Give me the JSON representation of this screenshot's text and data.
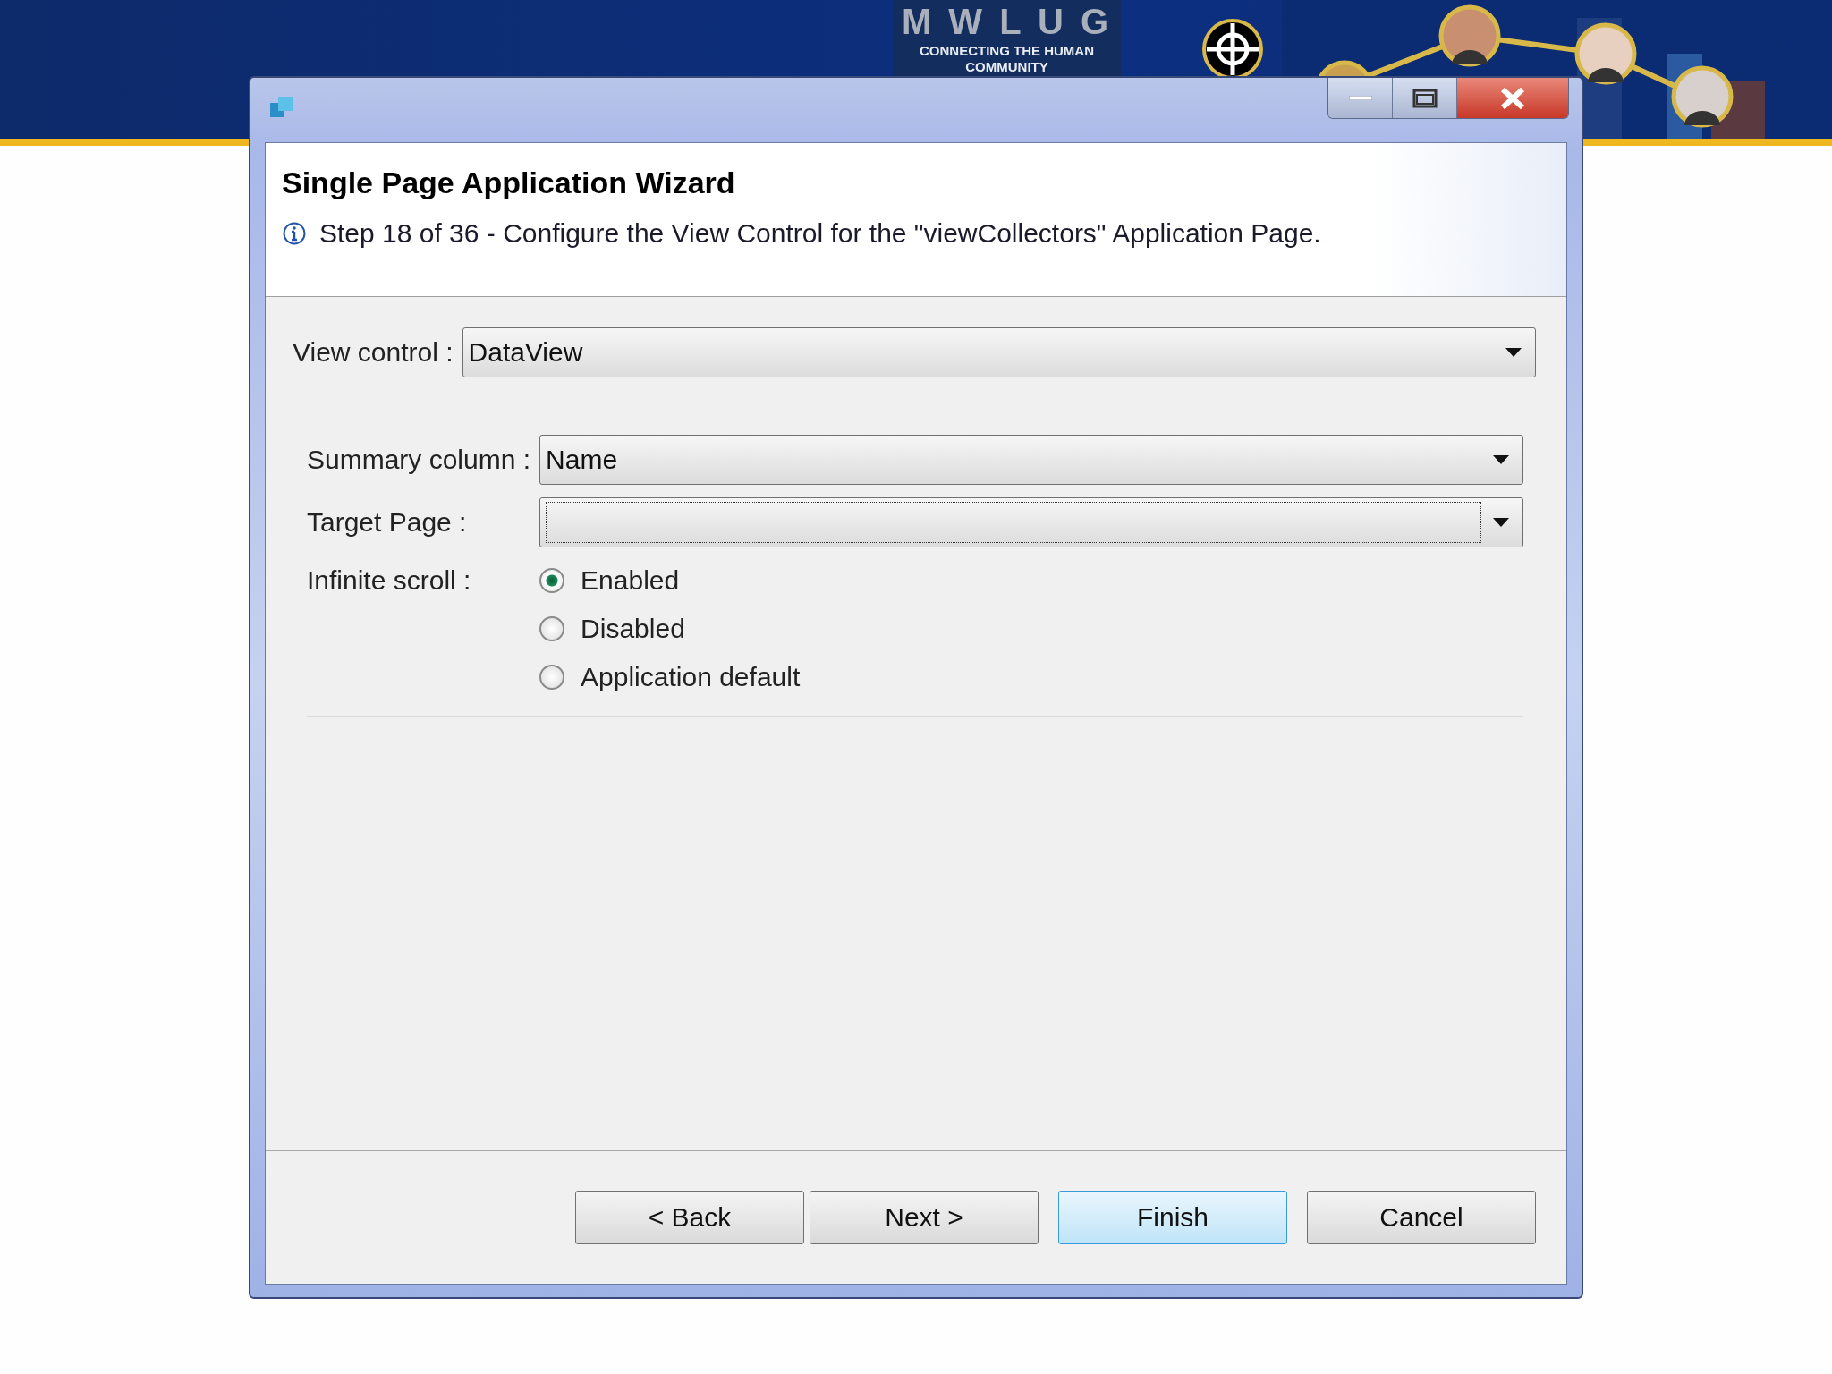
{
  "banner": {
    "logo": {
      "letters": "M W L U G",
      "tagline": [
        "CONNECTING THE HUMAN",
        "COMMUNITY"
      ]
    }
  },
  "wizard": {
    "title": "Single Page Application Wizard",
    "message": "Step 18 of 36 - Configure the View Control for the \"viewCollectors\" Application Page.",
    "main_field": {
      "kind": "combo",
      "label": "View control :",
      "value": "DataView",
      "focused": false
    },
    "fields": [
      {
        "kind": "combo",
        "label": "Summary column :",
        "value": "Name",
        "focused": false
      },
      {
        "kind": "combo",
        "label": "Target Page :",
        "focused": true
      },
      {
        "kind": "radio",
        "label": "Infinite scroll :",
        "options": [
          {
            "label": "Enabled",
            "selected": true
          },
          {
            "label": "Disabled",
            "selected": false
          },
          {
            "label": "Application default",
            "selected": false
          }
        ]
      }
    ],
    "buttons": [
      {
        "label": "< Back",
        "default": false
      },
      {
        "label": "Next >",
        "default": false
      },
      {
        "label": "Finish",
        "default": true
      },
      {
        "label": "Cancel",
        "default": false
      }
    ]
  }
}
